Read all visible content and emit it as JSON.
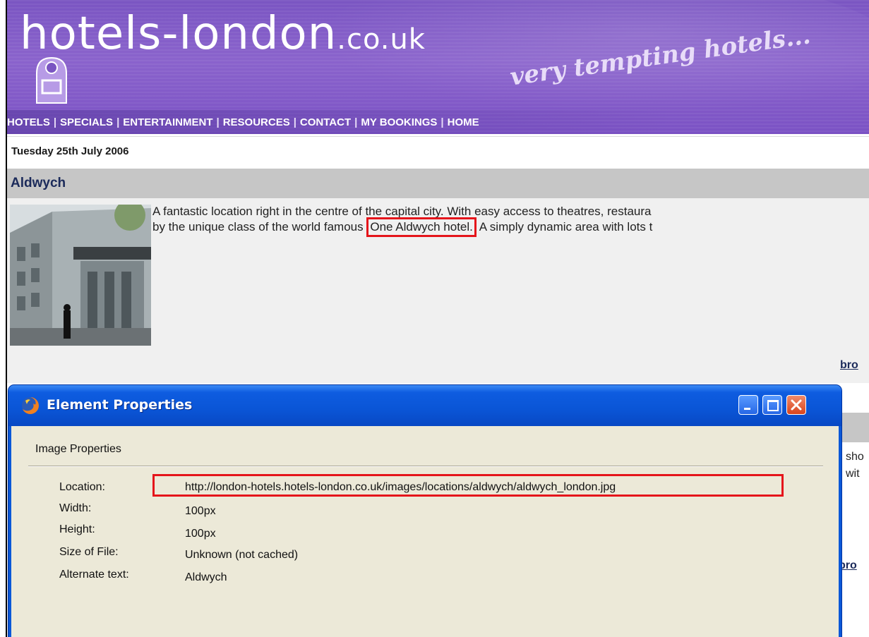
{
  "header": {
    "logo_main": "hotels-london",
    "logo_suffix": ".co.uk",
    "tagline": "very tempting hotels...",
    "nav": [
      "HOTELS",
      "SPECIALS",
      "ENTERTAINMENT",
      "RESOURCES",
      "CONTACT",
      "MY BOOKINGS",
      "HOME"
    ],
    "nav_separator": "|"
  },
  "date": "Tuesday 25th July 2006",
  "section": {
    "title": "Aldwych",
    "description_line1": "A fantastic location right in the centre of the capital city. With easy access to theatres, restaura",
    "description_line2_before": "by the unique class of the world famous",
    "hotel_link": "One Aldwych hotel.",
    "description_line2_after": "A simply dynamic area with lots t",
    "browse_partial": "bro"
  },
  "lower": {
    "text_line1": "sho",
    "text_line2": "wit",
    "browse_partial": "bro"
  },
  "dialog": {
    "title": "Element Properties",
    "group": "Image Properties",
    "properties": [
      {
        "label": "Location:",
        "value": "http://london-hotels.hotels-london.co.uk/images/locations/aldwych/aldwych_london.jpg"
      },
      {
        "label": "Width:",
        "value": "100px"
      },
      {
        "label": "Height:",
        "value": "100px"
      },
      {
        "label": "Size of File:",
        "value": "Unknown (not cached)"
      },
      {
        "label": "Alternate text:",
        "value": "Aldwych"
      }
    ]
  },
  "colors": {
    "header_purple": "#7a55c2",
    "dialog_blue": "#0a58d8",
    "highlight_red": "#e5151b",
    "section_gray": "#c6c6c6"
  }
}
